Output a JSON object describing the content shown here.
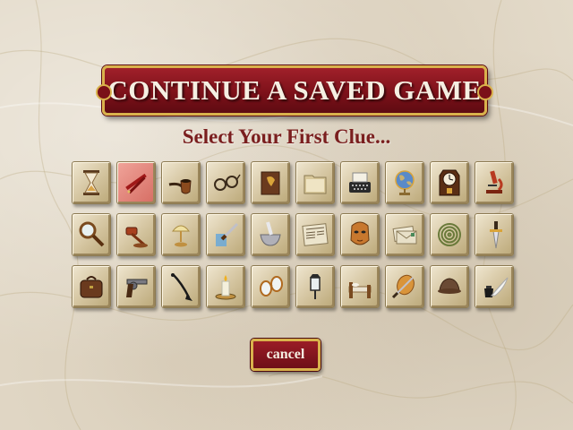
{
  "title": "Continue a Saved Game",
  "subtitle": "Select Your First Clue...",
  "cancel_label": "cancel",
  "colors": {
    "banner": "#7a1018",
    "banner_border": "#d9b24c",
    "subtitle": "#7a1e1e",
    "tile": "#d8c9a6",
    "tile_selected": "#e08878"
  },
  "clues": [
    [
      {
        "icon": "hourglass-icon"
      },
      {
        "icon": "pen-and-pencil-icon",
        "selected": true
      },
      {
        "icon": "pipe-icon"
      },
      {
        "icon": "spectacles-icon"
      },
      {
        "icon": "notebook-icon"
      },
      {
        "icon": "file-folder-icon"
      },
      {
        "icon": "typewriter-icon"
      },
      {
        "icon": "globe-icon"
      },
      {
        "icon": "wall-clock-icon"
      },
      {
        "icon": "microscope-icon"
      }
    ],
    [
      {
        "icon": "magnifying-glass-icon"
      },
      {
        "icon": "gavel-icon"
      },
      {
        "icon": "table-lamp-icon"
      },
      {
        "icon": "knife-and-glass-icon"
      },
      {
        "icon": "mortar-and-pestle-icon"
      },
      {
        "icon": "newspaper-icon"
      },
      {
        "icon": "egyptian-mask-icon"
      },
      {
        "icon": "letters-icon"
      },
      {
        "icon": "rope-coil-icon"
      },
      {
        "icon": "dagger-icon"
      }
    ],
    [
      {
        "icon": "doctor-bag-icon"
      },
      {
        "icon": "revolver-icon"
      },
      {
        "icon": "riding-crop-icon"
      },
      {
        "icon": "candle-icon"
      },
      {
        "icon": "pince-nez-icon"
      },
      {
        "icon": "lantern-icon"
      },
      {
        "icon": "bed-icon"
      },
      {
        "icon": "loaf-and-knife-icon"
      },
      {
        "icon": "deerstalker-hat-icon"
      },
      {
        "icon": "ink-and-quill-icon"
      }
    ]
  ]
}
